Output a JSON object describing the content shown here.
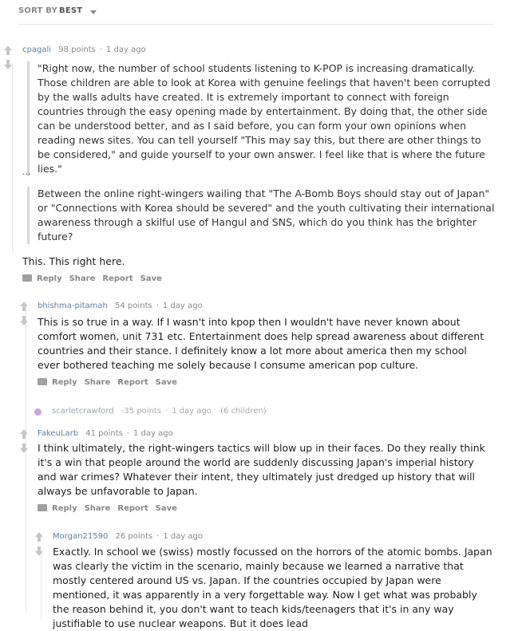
{
  "sort": {
    "label": "SORT BY",
    "value": "BEST"
  },
  "comments": [
    {
      "author": "cpagali",
      "points": "98 points",
      "age": "1 day ago",
      "quote1": "\"Right now, the number of school students listening to K-POP is increasing dramatically. Those children are able to look at Korea with genuine feelings that haven't been corrupted by the walls adults have created. It is extremely important to connect with foreign countries through the easy opening made by entertainment. By doing that, the other side can be understood better, and as I said before, you can form your own opinions when reading news sites. You can tell yourself \"This may say this, but there are other things to be considered,\" and guide yourself to your own answer. I feel like that is where the future lies.\"",
      "ellipsis": "...",
      "quote2": "Between the online right-wingers wailing that \"The A-Bomb Boys should stay out of Japan\" or \"Connections with Korea should be severed\" and the youth cultivating their international awareness through a skilful use of Hangul and SNS, which do you think has the brighter future?",
      "text": "This. This right here."
    },
    {
      "author": "bhishma-pitamah",
      "points": "54 points",
      "age": "1 day ago",
      "text": "This is so true in a way. If I wasn't into kpop then I wouldn't have never known about comfort women, unit 731 etc. Entertainment does help spread awareness about different countries and their stance. I definitely know a lot more about america then my school ever bothered teaching me solely because I consume american pop culture."
    },
    {
      "author": "scarletcrawford",
      "points": "-35 points",
      "age": "1 day ago",
      "children": "(6 children)"
    },
    {
      "author": "FakeuLarb",
      "points": "41 points",
      "age": "1 day ago",
      "text": "I think ultimately, the right-wingers tactics will blow up in their faces. Do they really think it's a win that people around the world are suddenly discussing Japan's imperial history and war crimes? Whatever their intent, they ultimately just dredged up history that will always be unfavorable to Japan."
    },
    {
      "author": "Morgan21590",
      "points": "26 points",
      "age": "1 day ago",
      "text": "Exactly. In school we (swiss) mostly focussed on the horrors of the atomic bombs. Japan was clearly the victim in the scenario, mainly because we learned a narrative that mostly centered around US vs. Japan. If the countries occupied by Japan were mentioned, it was apparently in a very forgettable way. Now I get what was probably the reason behind it, you don't want to teach kids/teenagers that it's in any way justifiable to use nuclear weapons. But it does lead"
    }
  ],
  "actions": {
    "reply": "Reply",
    "share": "Share",
    "report": "Report",
    "save": "Save"
  },
  "icons": {
    "upvote": "upvote-icon",
    "downvote": "downvote-icon",
    "reply": "reply-icon",
    "collapsed": "collapsed-comment-icon"
  },
  "colors": {
    "author": "#5f7fa8",
    "meta": "#888888",
    "collapsed": "#c9a6d6"
  }
}
